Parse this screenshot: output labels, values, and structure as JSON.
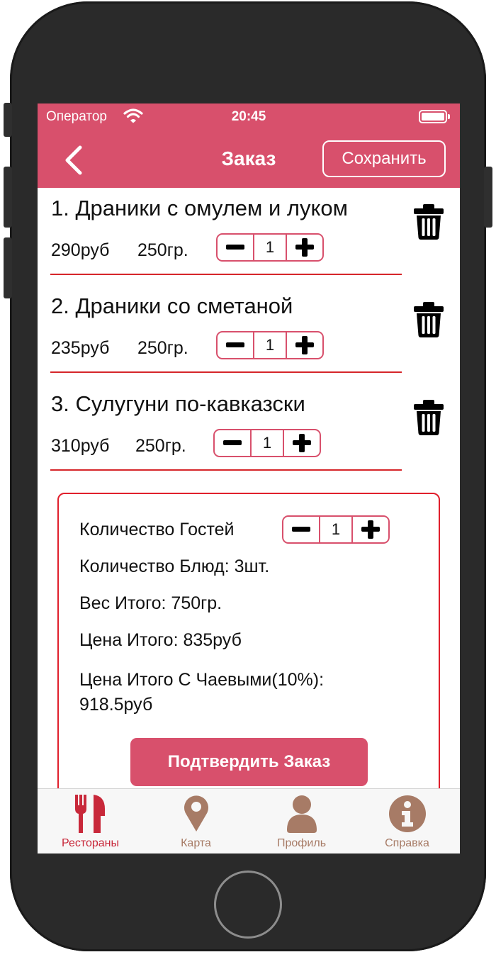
{
  "status_bar": {
    "carrier": "Оператор",
    "time": "20:45"
  },
  "nav": {
    "title": "Заказ",
    "save_label": "Сохранить"
  },
  "items": [
    {
      "name": "1. Драники с омулем и луком",
      "price": "290руб",
      "weight": "250гр.",
      "qty": "1"
    },
    {
      "name": "2. Драники со сметаной",
      "price": "235руб",
      "weight": "250гр.",
      "qty": "1"
    },
    {
      "name": "3. Сулугуни по-кавказски",
      "price": "310руб",
      "weight": "250гр.",
      "qty": "1"
    }
  ],
  "summary": {
    "guests_label": "Количество Гостей",
    "guests_value": "1",
    "dishes": "Количество Блюд: 3шт.",
    "weight_total": "Вес Итого: 750гр.",
    "price_total": "Цена Итого: 835руб",
    "price_tips_line1": "Цена Итого С Чаевыми(10%):",
    "price_tips_line2": "918.5руб",
    "confirm_label": "Подтвердить Заказ"
  },
  "tabs": [
    {
      "label": "Рестораны",
      "icon": "restaurant-icon",
      "active": true
    },
    {
      "label": "Карта",
      "icon": "map-pin-icon",
      "active": false
    },
    {
      "label": "Профиль",
      "icon": "profile-icon",
      "active": false
    },
    {
      "label": "Справка",
      "icon": "info-icon",
      "active": false
    }
  ],
  "colors": {
    "accent": "#d8506c",
    "separator": "#d6262a",
    "tab_active": "#c8283a",
    "tab_inactive": "#a77b66"
  }
}
